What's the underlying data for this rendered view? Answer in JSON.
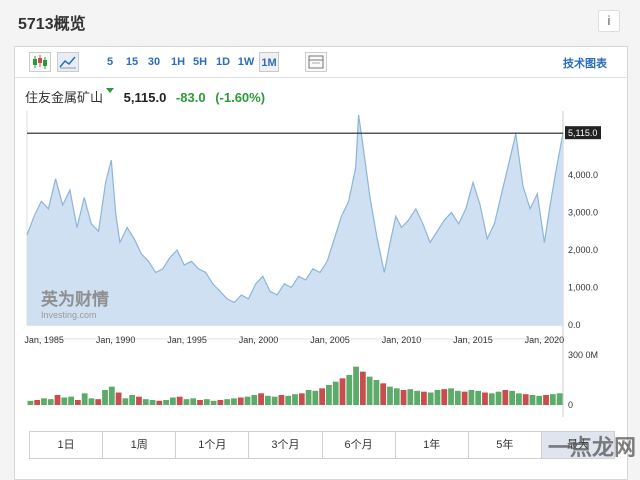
{
  "page_title": "5713概览",
  "info_label": "i",
  "toolbar": {
    "intervals": [
      "5",
      "15",
      "30",
      "1H",
      "5H",
      "1D",
      "1W",
      "1M"
    ],
    "active_interval": "1M",
    "tech_chart_label": "技术图表",
    "candlestick_icon": "candlestick-icon",
    "area_icon": "area-chart-icon",
    "settings_icon": "panel-icon"
  },
  "stock": {
    "name": "住友金属矿山",
    "price": "5,115.0",
    "change": "-83.0",
    "change_pct": "(-1.60%)",
    "down_color": "#2a9a3a"
  },
  "logo": {
    "text": "英为财情",
    "sub": "Investing.com"
  },
  "range_buttons": [
    "1日",
    "1周",
    "1个月",
    "3个月",
    "6个月",
    "1年",
    "5年",
    "最大"
  ],
  "active_range": "最大",
  "watermark": "一点龙网",
  "chart_data": {
    "type": "area",
    "price_axis": {
      "ticks": [
        0,
        1000,
        2000,
        3000,
        4000
      ],
      "tick_labels": [
        "0.0",
        "1,000.0",
        "2,000.0",
        "3,000.0",
        "4,000.0"
      ],
      "ylim": [
        0,
        5600
      ]
    },
    "last_price_label": "5,115.0",
    "last_price": 5115,
    "x_tick_labels": [
      "Jan, 1985",
      "Jan, 1990",
      "Jan, 1995",
      "Jan, 2000",
      "Jan, 2005",
      "Jan, 2010",
      "Jan, 2015",
      "Jan, 2020"
    ],
    "x_ticks": [
      1985,
      1990,
      1995,
      2000,
      2005,
      2010,
      2015,
      2020
    ],
    "xlim": [
      1983.8,
      2021.3
    ],
    "area_color": "#cfe0f3",
    "line_color": "#8db4dc",
    "series": [
      {
        "x": [
          1983.8,
          1984.3,
          1984.8,
          1985.3,
          1985.8,
          1986.3,
          1986.8,
          1987.3,
          1987.8,
          1988.3,
          1988.8,
          1989.3,
          1989.7,
          1990.0,
          1990.3,
          1990.8,
          1991.3,
          1991.8,
          1992.3,
          1992.8,
          1993.3,
          1993.8,
          1994.3,
          1994.8,
          1995.3,
          1995.8,
          1996.3,
          1996.8,
          1997.3,
          1997.8,
          1998.3,
          1998.8,
          1999.3,
          1999.8,
          2000.3,
          2000.8,
          2001.3,
          2001.8,
          2002.3,
          2002.8,
          2003.3,
          2003.8,
          2004.3,
          2004.8,
          2005.3,
          2005.8,
          2006.3,
          2006.8,
          2007.0,
          2007.3,
          2007.8,
          2008.3,
          2008.8,
          2009.2,
          2009.6,
          2010.0,
          2010.5,
          2011.0,
          2011.5,
          2012.0,
          2012.5,
          2013.0,
          2013.5,
          2014.0,
          2014.5,
          2015.0,
          2015.5,
          2016.0,
          2016.5,
          2017.0,
          2017.5,
          2018.0,
          2018.5,
          2019.0,
          2019.5,
          2020.0,
          2020.4,
          2020.8,
          2021.3
        ],
        "values": [
          2400,
          2900,
          3300,
          3100,
          3900,
          3200,
          3600,
          2600,
          3400,
          2700,
          2500,
          3800,
          4400,
          3000,
          2200,
          2600,
          2300,
          1900,
          1700,
          1400,
          1500,
          1800,
          2000,
          1600,
          1700,
          1500,
          1400,
          1100,
          900,
          700,
          600,
          800,
          700,
          1100,
          1300,
          900,
          800,
          1100,
          1000,
          1300,
          1200,
          1500,
          1400,
          1700,
          2300,
          2900,
          3300,
          4200,
          5600,
          4800,
          3400,
          2300,
          1400,
          2200,
          2900,
          2600,
          2800,
          3100,
          2700,
          2200,
          2500,
          2800,
          3000,
          2700,
          3100,
          3800,
          3200,
          2300,
          2700,
          3500,
          4300,
          5100,
          3700,
          3100,
          3500,
          2200,
          3200,
          4100,
          5115
        ]
      }
    ],
    "volume": {
      "label": "300 0M",
      "zero_label": "0",
      "ylim": [
        0,
        300
      ],
      "values": [
        25,
        30,
        40,
        35,
        60,
        45,
        50,
        30,
        70,
        40,
        35,
        90,
        110,
        75,
        40,
        60,
        50,
        35,
        30,
        25,
        30,
        45,
        50,
        35,
        40,
        30,
        35,
        25,
        30,
        35,
        40,
        45,
        50,
        60,
        70,
        55,
        50,
        60,
        55,
        65,
        70,
        90,
        85,
        100,
        120,
        140,
        160,
        180,
        230,
        200,
        170,
        150,
        130,
        110,
        100,
        90,
        95,
        85,
        80,
        75,
        90,
        95,
        100,
        85,
        80,
        90,
        85,
        75,
        70,
        80,
        90,
        85,
        70,
        65,
        60,
        55,
        60,
        65,
        70
      ],
      "up_color": "#5cab6a",
      "down_color": "#c84d4d"
    }
  }
}
